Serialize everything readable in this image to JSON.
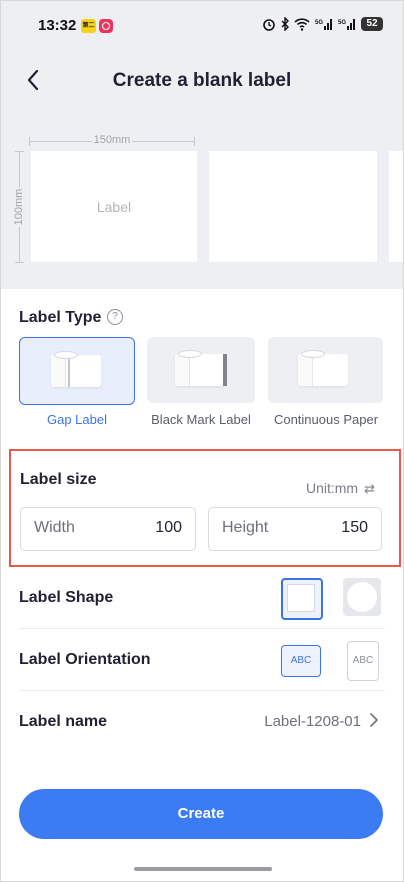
{
  "status_bar": {
    "time": "13:32",
    "app_badge_text": "第二",
    "network": "5G",
    "battery": "52"
  },
  "header": {
    "title": "Create a blank label"
  },
  "preview": {
    "width_dim": "150mm",
    "height_dim": "100mm",
    "card_text": "Label"
  },
  "label_type": {
    "title": "Label Type",
    "options": [
      {
        "label": "Gap Label",
        "selected": true
      },
      {
        "label": "Black Mark Label",
        "selected": false
      },
      {
        "label": "Continuous Paper",
        "selected": false
      }
    ]
  },
  "label_size": {
    "title": "Label size",
    "unit": "Unit:mm",
    "width": {
      "placeholder": "Width",
      "value": "100"
    },
    "height": {
      "placeholder": "Height",
      "value": "150"
    }
  },
  "label_shape": {
    "title": "Label Shape",
    "options": [
      "rectangle",
      "circle"
    ],
    "selected": "rectangle"
  },
  "label_orientation": {
    "title": "Label Orientation",
    "horizontal_text": "ABC",
    "vertical_text": "ABC",
    "selected": "horizontal"
  },
  "label_name": {
    "title": "Label name",
    "value": "Label-1208-01"
  },
  "actions": {
    "create": "Create"
  },
  "colors": {
    "accent": "#3c7cf3",
    "highlight_border": "#e8584b"
  }
}
